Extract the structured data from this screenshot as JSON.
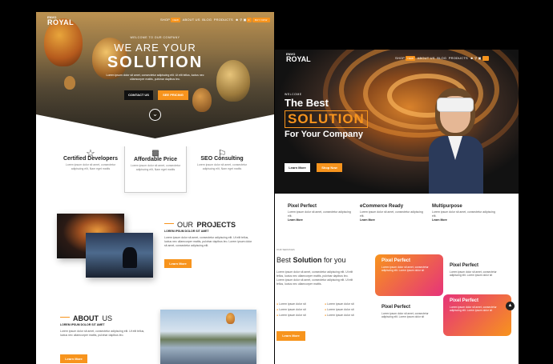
{
  "left": {
    "logo_top": "ENVO",
    "logo_main": "ROYAL",
    "nav": [
      "SHOP",
      "ABOUT US",
      "BLOG",
      "PRODUCTS"
    ],
    "nav_badge": "NEW",
    "cart_badge": "0",
    "buy_label": "BUY NOW",
    "hero": {
      "kicker": "WELCOME TO OUR COMPANY",
      "title_line1": "WE ARE YOUR",
      "title_line2": "SOLUTION",
      "text": "Lorem ipsum dolor sit amet, consectetur adipiscing elit. Ut elit tellus, luctus nec ullamcorper mattis, pulvinar dapibus leo.",
      "btn_contact": "CONTACT US",
      "btn_pricing": "SEE PRICING"
    },
    "features": [
      {
        "title": "Certified Developers",
        "text": "Lorem ipsum dolor sit amet, consectetur adipiscing elit, Nam eget mattis"
      },
      {
        "title": "Affordable Price",
        "text": "Lorem ipsum dolor sit amet, consectetur adipiscing elit, Nam eget mattis"
      },
      {
        "title": "SEO Consulting",
        "text": "Lorem ipsum dolor sit amet, consectetur adipiscing elit, Nam eget mattis"
      }
    ],
    "projects": {
      "title_light": "OUR",
      "title_bold": "PROJECTS",
      "subtitle": "LOREM IPSUM DOLOR SIT AMET",
      "text": "Lorem ipsum dolor sit amet, consectetur adipiscing elit. Ut elit tellus, luctus nec ullamcorper mattis, pulvinar dapibus leo. Lorem ipsum dolor sit amet, consectetur adipiscing elit.",
      "btn": "Learn More"
    },
    "about": {
      "title_bold": "ABOUT",
      "title_light": "US",
      "subtitle": "LOREM IPSUM DOLOR SIT AMET",
      "text": "Lorem ipsum dolor sit amet, consectetur adipiscing elit. Ut elit tellus, luctus nec ullamcorper mattis, pulvinar dapibus leo.",
      "btn": "Learn More"
    }
  },
  "right": {
    "logo_top": "ENVO",
    "logo_main": "ROYAL",
    "nav": [
      "SHOP",
      "ABOUT US",
      "BLOG",
      "PRODUCTS"
    ],
    "nav_badge": "NEW",
    "hero": {
      "kicker": "WELCOME",
      "line1": "The Best",
      "line2": "SOLUTION",
      "line3": "For Your Company",
      "btn_more": "Learn More",
      "btn_shop": "Shop Now"
    },
    "features": [
      {
        "title": "Pixel Perfect",
        "text": "Lorem ipsum dolor sit amet, consectetur adipiscing elit.",
        "link": "Learn More"
      },
      {
        "title": "eCommerce Ready",
        "text": "Lorem ipsum dolor sit amet, consectetur adipiscing elit.",
        "link": "Learn More"
      },
      {
        "title": "Multipurpose",
        "text": "Lorem ipsum dolor sit amet, consectetur adipiscing elit.",
        "link": "Learn More"
      }
    ],
    "services": {
      "kicker": "OUR SERVICES",
      "title_pre": "Best ",
      "title_bold": "Solution",
      "title_post": " for you",
      "text": "Lorem ipsum dolor sit amet, consectetur adipiscing elit. Ut elit tellus, luctus nec ullamcorper mattis, pulvinar dapibus leo. Lorem ipsum dolor sit amet, consectetur adipiscing elit. Ut elit tellus, luctus nec ullamcorper mattis.",
      "list": [
        "Lorem ipsum dolor sit",
        "Lorem ipsum dolor sit",
        "Lorem ipsum dolor sit",
        "Lorem ipsum dolor sit",
        "Lorem ipsum dolor sit",
        "Lorem ipsum dolor sit"
      ],
      "btn": "Learn More",
      "cards": [
        {
          "title": "Pixel Perfect",
          "text": "Lorem ipsum dolor sit amet, consectetur adipiscing elit. Lorem ipsum dolor sit"
        },
        {
          "title": "Pixel Perfect",
          "text": "Lorem ipsum dolor sit amet, consectetur adipiscing elit. Lorem ipsum dolor sit"
        },
        {
          "title": "Pixel Perfect",
          "text": "Lorem ipsum dolor sit amet, consectetur adipiscing elit. Lorem ipsum dolor sit"
        },
        {
          "title": "Pixel Perfect",
          "text": "Lorem ipsum dolor sit amet, consectetur adipiscing elit. Lorem ipsum dolor sit"
        }
      ]
    }
  },
  "colors": {
    "accent": "#f7941d",
    "dark": "#1c1c1c",
    "gradient_pink": "#e6337a"
  }
}
